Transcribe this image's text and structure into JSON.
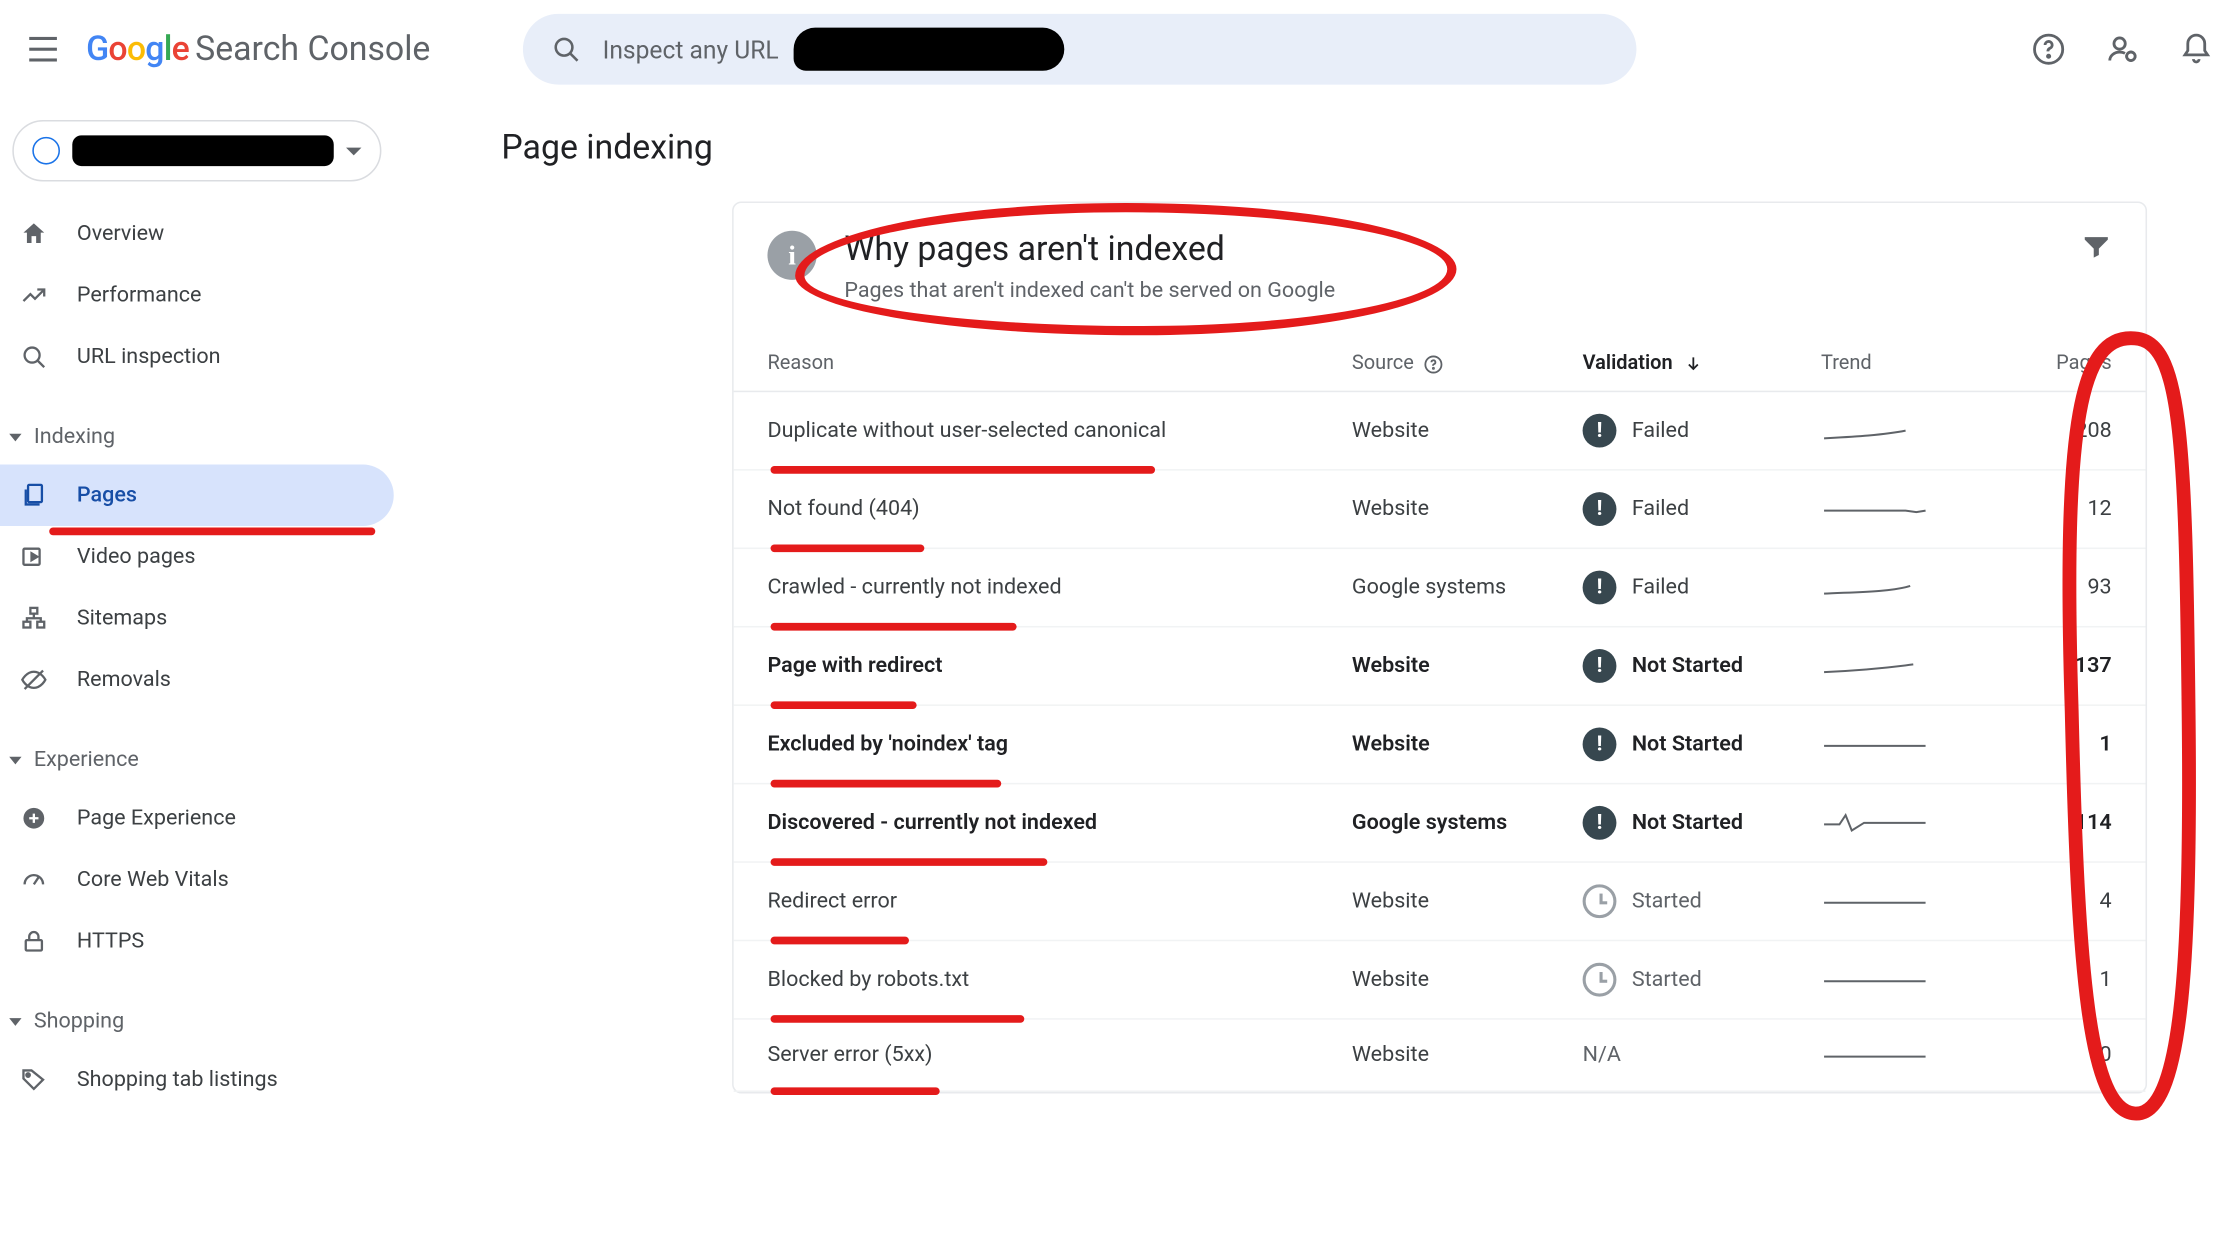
{
  "header": {
    "logo_product": "Search Console",
    "search_placeholder": "Inspect any URL"
  },
  "sidebar": {
    "items": [
      {
        "icon": "home",
        "label": "Overview"
      },
      {
        "icon": "trend",
        "label": "Performance"
      },
      {
        "icon": "search",
        "label": "URL inspection"
      }
    ],
    "sections": [
      {
        "title": "Indexing",
        "items": [
          {
            "icon": "pages",
            "label": "Pages",
            "active": true
          },
          {
            "icon": "video",
            "label": "Video pages"
          },
          {
            "icon": "sitemap",
            "label": "Sitemaps"
          },
          {
            "icon": "removals",
            "label": "Removals"
          }
        ]
      },
      {
        "title": "Experience",
        "items": [
          {
            "icon": "plus-circle",
            "label": "Page Experience"
          },
          {
            "icon": "gauge",
            "label": "Core Web Vitals"
          },
          {
            "icon": "lock",
            "label": "HTTPS"
          }
        ]
      },
      {
        "title": "Shopping",
        "items": [
          {
            "icon": "tag",
            "label": "Shopping tab listings"
          }
        ]
      }
    ]
  },
  "main": {
    "page_title": "Page indexing",
    "card": {
      "title": "Why pages aren't indexed",
      "subtitle": "Pages that aren't indexed can't be served on Google",
      "columns": {
        "reason": "Reason",
        "source": "Source",
        "validation": "Validation",
        "trend": "Trend",
        "pages": "Pages"
      },
      "rows": [
        {
          "reason": "Duplicate without user-selected canonical",
          "source": "Website",
          "validation": "Failed",
          "vicon": "error",
          "pages": 208,
          "bold": false
        },
        {
          "reason": "Not found (404)",
          "source": "Website",
          "validation": "Failed",
          "vicon": "error",
          "pages": 12,
          "bold": false
        },
        {
          "reason": "Crawled - currently not indexed",
          "source": "Google systems",
          "validation": "Failed",
          "vicon": "error",
          "pages": 93,
          "bold": false
        },
        {
          "reason": "Page with redirect",
          "source": "Website",
          "validation": "Not Started",
          "vicon": "error",
          "pages": 137,
          "bold": true
        },
        {
          "reason": "Excluded by 'noindex' tag",
          "source": "Website",
          "validation": "Not Started",
          "vicon": "error",
          "pages": 1,
          "bold": true
        },
        {
          "reason": "Discovered - currently not indexed",
          "source": "Google systems",
          "validation": "Not Started",
          "vicon": "error",
          "pages": 114,
          "bold": true
        },
        {
          "reason": "Redirect error",
          "source": "Website",
          "validation": "Started",
          "vicon": "clock",
          "pages": 4,
          "bold": false
        },
        {
          "reason": "Blocked by robots.txt",
          "source": "Website",
          "validation": "Started",
          "vicon": "clock",
          "pages": 1,
          "bold": false
        },
        {
          "reason": "Server error (5xx)",
          "source": "Website",
          "validation": "N/A",
          "vicon": "none",
          "pages": 0,
          "bold": false
        }
      ]
    }
  }
}
